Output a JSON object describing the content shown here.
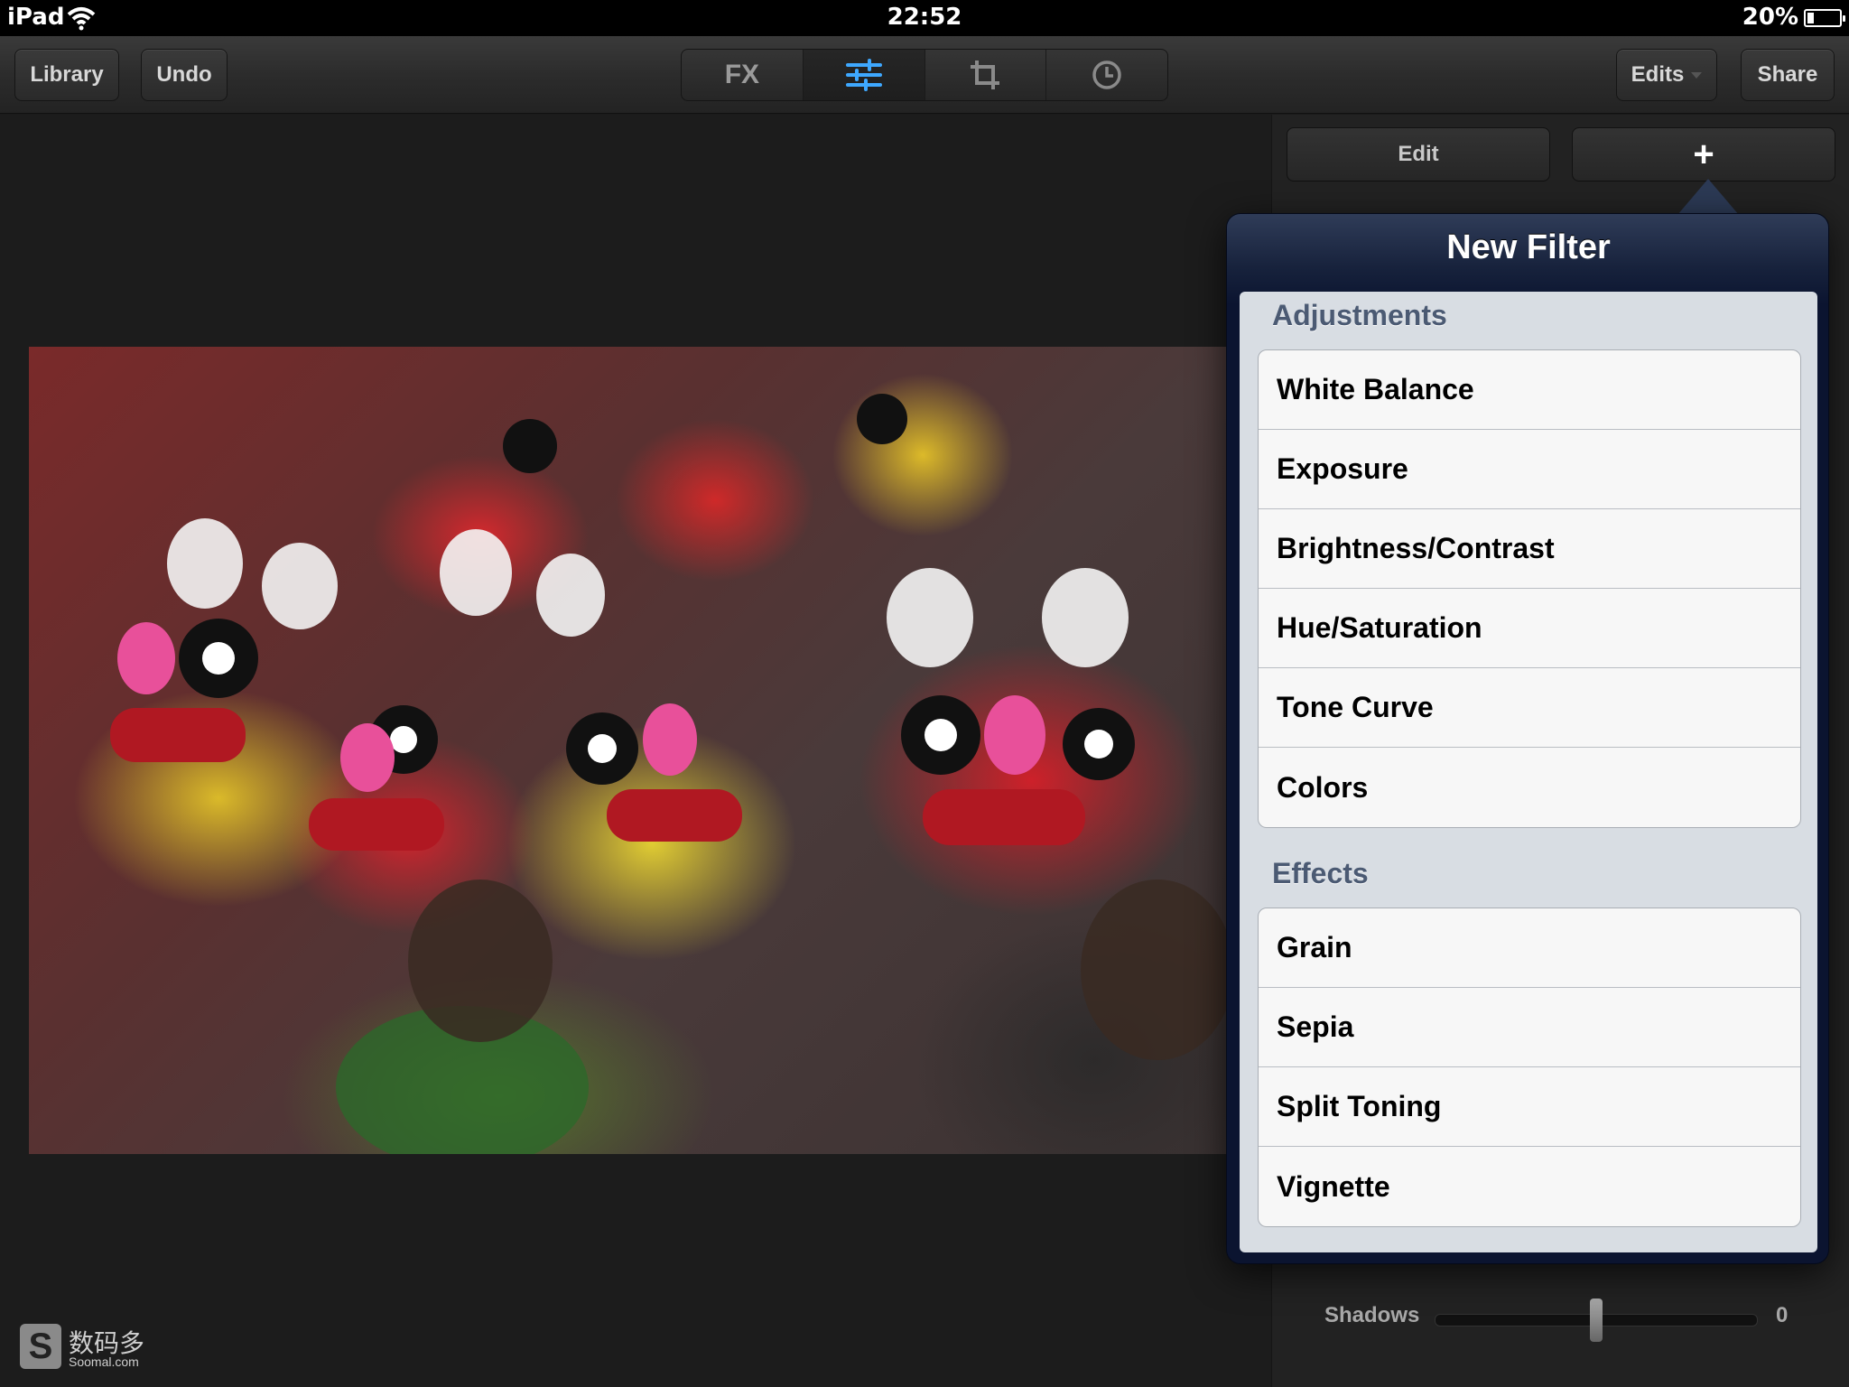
{
  "status_bar": {
    "device": "iPad",
    "time": "22:52",
    "battery_percent": "20%",
    "battery_level": 0.2
  },
  "toolbar": {
    "library_label": "Library",
    "undo_label": "Undo",
    "fx_label": "FX",
    "edits_label": "Edits",
    "share_label": "Share"
  },
  "panel": {
    "edit_label": "Edit",
    "add_label": "+",
    "shadows_label": "Shadows",
    "shadows_value": "0",
    "shadows_position": 0.5
  },
  "popover": {
    "title": "New Filter",
    "sections": [
      {
        "header": "Adjustments",
        "items": [
          "White Balance",
          "Exposure",
          "Brightness/Contrast",
          "Hue/Saturation",
          "Tone Curve",
          "Colors"
        ]
      },
      {
        "header": "Effects",
        "items": [
          "Grain",
          "Sepia",
          "Split Toning",
          "Vignette"
        ]
      }
    ]
  },
  "watermark": {
    "text": "数码多",
    "subtext": "Soomal.com"
  },
  "icons": {
    "wifi": "wifi-icon",
    "sliders": "sliders-icon",
    "crop": "crop-icon",
    "clock": "clock-icon",
    "dropdown": "chevron-down-icon"
  }
}
